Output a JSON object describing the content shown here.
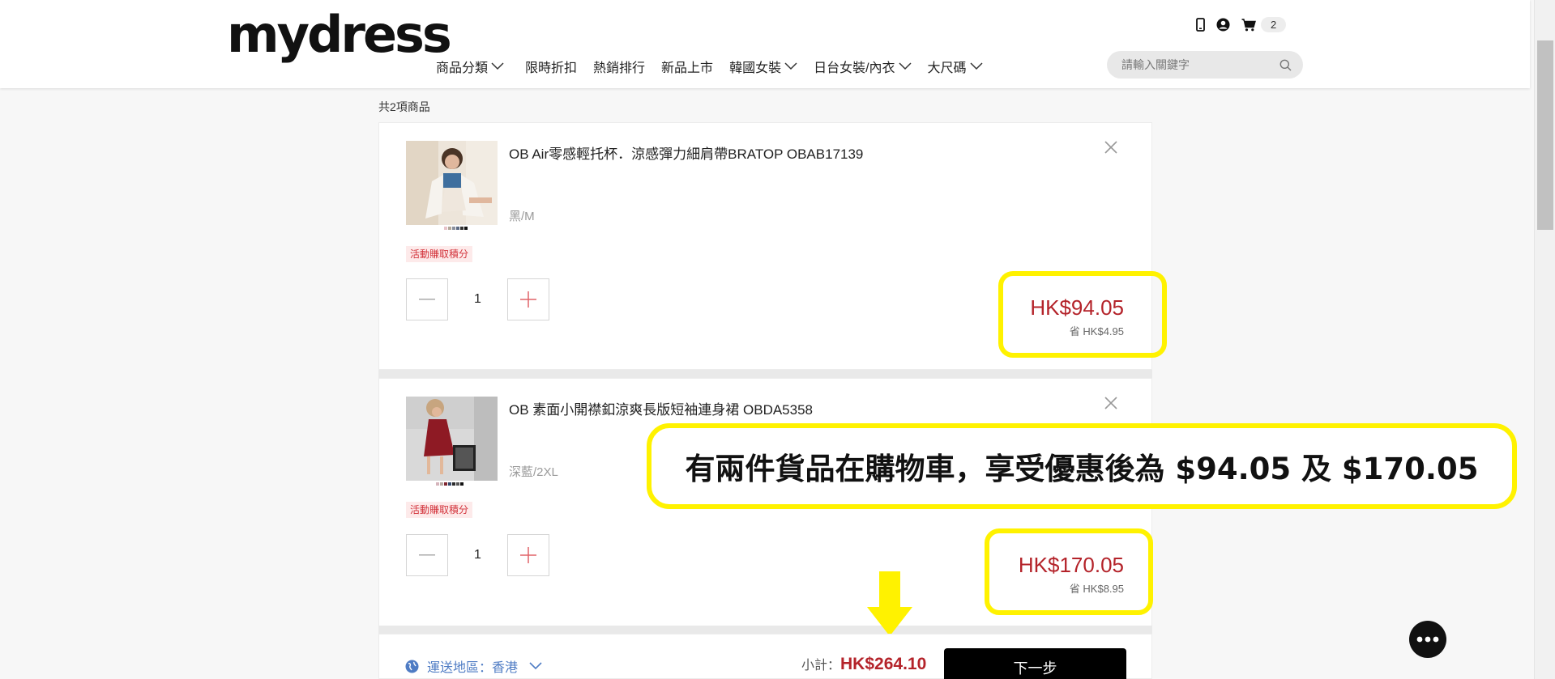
{
  "header": {
    "logo": "mydress",
    "nav": [
      {
        "label": "商品分類",
        "dropdown": true
      },
      {
        "label": "限時折扣",
        "dropdown": false
      },
      {
        "label": "熱銷排行",
        "dropdown": false
      },
      {
        "label": "新品上市",
        "dropdown": false
      },
      {
        "label": "韓國女裝",
        "dropdown": true
      },
      {
        "label": "日台女裝/內衣",
        "dropdown": true
      },
      {
        "label": "大尺碼",
        "dropdown": true
      }
    ],
    "cart_count": "2",
    "search_placeholder": "請輸入關鍵字"
  },
  "cart": {
    "count_label": "共2項商品",
    "items": [
      {
        "title": "OB Air零感輕托杯．涼感彈力細肩帶BRATOP OBAB17139",
        "variant": "黑/M",
        "badge": "活動賺取積分",
        "quantity": "1",
        "price": "HK$94.05",
        "saving": "省 HK$4.95"
      },
      {
        "title": "OB 素面小開襟釦涼爽長版短袖連身裙 OBDA5358",
        "variant": "深藍/2XL",
        "badge": "活動賺取積分",
        "quantity": "1",
        "price": "HK$170.05",
        "saving": "省 HK$8.95"
      }
    ],
    "region_label": "運送地區：香港",
    "subtotal_label": "小計：",
    "subtotal_value": "HK$264.10",
    "next_label": "下一步"
  },
  "annotation": {
    "text": "有兩件貨品在購物車，享受優惠後為 $94.05 及 $170.05"
  },
  "colors": {
    "price_red": "#b4232a",
    "highlight_yellow": "#fff200",
    "region_blue": "#4f7cc4"
  }
}
